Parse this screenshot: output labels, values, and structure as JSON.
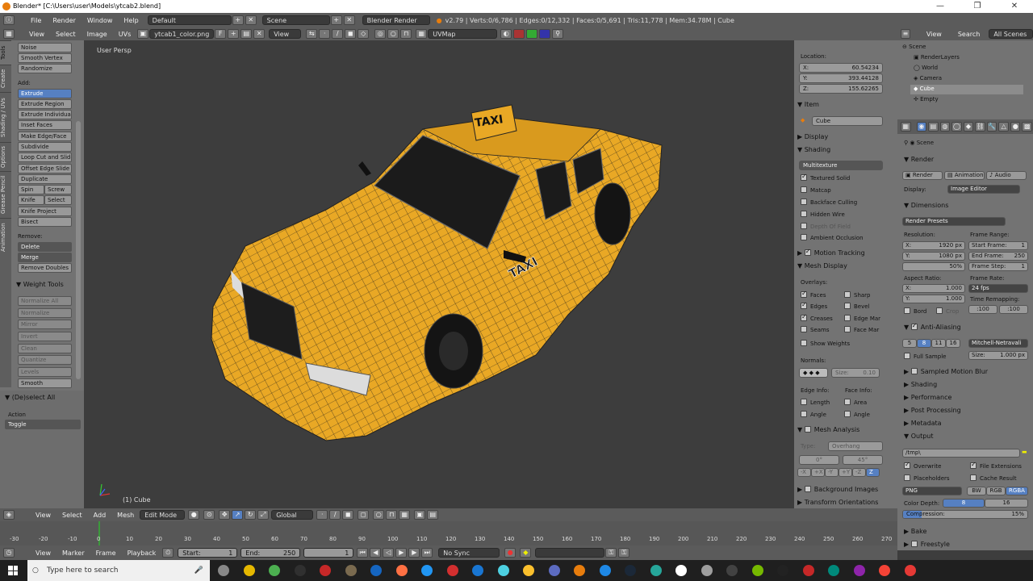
{
  "titlebar": {
    "title": "Blender* [C:\\Users\\user\\Models\\ytcab2.blend]",
    "min": "—",
    "max": "❐",
    "close": "✕"
  },
  "infobar": {
    "menus": [
      "File",
      "Render",
      "Window",
      "Help"
    ],
    "screen": "Default",
    "scene": "Scene",
    "engine": "Blender Render",
    "stats": "v2.79 | Verts:0/6,786 | Edges:0/12,332 | Faces:0/5,691 | Tris:11,778 | Mem:34.78M | Cube"
  },
  "imageheader": {
    "menus": [
      "View",
      "Select",
      "Image",
      "UVs"
    ],
    "image": "ytcab1_color.png",
    "f": "F",
    "view": "View",
    "uvmap": "UVMap"
  },
  "tooltabs": [
    "Tools",
    "Create",
    "Shading / UVs",
    "Options",
    "Grease Pencil",
    "Animation"
  ],
  "tools": {
    "top": [
      "Noise",
      "Smooth Vertex",
      "Randomize"
    ],
    "add_label": "Add:",
    "extrude": "Extrude",
    "add": [
      "Extrude Region",
      "Extrude Individual",
      "Inset Faces",
      "Make Edge/Face",
      "Subdivide",
      "Loop Cut and Slide",
      "Offset Edge Slide",
      "Duplicate"
    ],
    "spin": "Spin",
    "screw": "Screw",
    "knife": "Knife",
    "select": "Select",
    "more": [
      "Knife Project",
      "Bisect"
    ],
    "remove_label": "Remove:",
    "delete": "Delete",
    "merge": "Merge",
    "remove_doubles": "Remove Doubles",
    "weight_title": "Weight Tools",
    "weight": [
      "Normalize All",
      "Normalize",
      "Mirror",
      "Invert",
      "Clean",
      "Quantize",
      "Levels"
    ],
    "smooth": "Smooth",
    "op_title": "(De)select All",
    "action_label": "Action",
    "action": "Toggle"
  },
  "viewport": {
    "label": "User Persp",
    "object": "(1) Cube",
    "sign": "TAXI",
    "door": "TAXI"
  },
  "npanel": {
    "location_label": "Location:",
    "x": "X:",
    "xv": "60.54234",
    "y": "Y:",
    "yv": "393.44128",
    "z": "Z:",
    "zv": "155.62265",
    "item": "Item",
    "item_name": "Cube",
    "display": "Display",
    "shading": "Shading",
    "shading_mode": "Multitexture",
    "shading_opts": [
      "Textured Solid",
      "Matcap",
      "Backface Culling",
      "Hidden Wire",
      "Depth Of Field",
      "Ambient Occlusion"
    ],
    "motion": "Motion Tracking",
    "mesh_display": "Mesh Display",
    "overlays": "Overlays:",
    "ov_left": [
      "Faces",
      "Edges",
      "Creases",
      "Seams",
      "Show Weights"
    ],
    "ov_right": [
      "Sharp",
      "Bevel",
      "Edge Mar",
      "Face Mar"
    ],
    "normals": "Normals:",
    "size": "Size:",
    "size_v": "0.10",
    "edge_info": "Edge Info:",
    "face_info": "Face Info:",
    "length": "Length",
    "angle": "Angle",
    "area": "Area",
    "angle2": "Angle",
    "mesh_analysis": "Mesh Analysis",
    "type": "Type:",
    "type_v": "Overhang",
    "deg0": "0°",
    "deg45": "45°",
    "axes": [
      "-X",
      "+X",
      "-Y",
      "+Y",
      "-Z",
      "Z"
    ],
    "bg_images": "Background Images",
    "transform_orient": "Transform Orientations"
  },
  "outliner": {
    "view": "View",
    "search": "Search",
    "all": "All Scenes",
    "items": [
      "Scene",
      "RenderLayers",
      "World",
      "Camera",
      "Cube",
      "Empty"
    ]
  },
  "props": {
    "scene": "Scene",
    "render": "Render",
    "btn_render": "Render",
    "btn_anim": "Animation",
    "btn_audio": "Audio",
    "display": "Display:",
    "display_v": "Image Editor",
    "dimensions": "Dimensions",
    "presets": "Render Presets",
    "resolution": "Resolution:",
    "frame_range": "Frame Range:",
    "rx": "X:",
    "rxv": "1920 px",
    "ry": "Y:",
    "ryv": "1080 px",
    "pct": "50%",
    "start": "Start Frame:",
    "start_v": "1",
    "end": "End Frame:",
    "end_v": "250",
    "step": "Frame Step:",
    "step_v": "1",
    "aspect": "Aspect Ratio:",
    "frame_rate": "Frame Rate:",
    "ax": "X:",
    "axv": "1.000",
    "ay": "Y:",
    "ayv": "1.000",
    "fps": "24 fps",
    "time_remap": "Time Remapping:",
    "old": ":100",
    "new": ":100",
    "bord": "Bord",
    "crop": "Crop",
    "aa": "Anti-Aliasing",
    "aa_vals": [
      "5",
      "8",
      "11",
      "16"
    ],
    "filter": "Mitchell-Netravali",
    "full_sample": "Full Sample",
    "fsize": "Size:",
    "fsize_v": "1.000 px",
    "sections": [
      "Sampled Motion Blur",
      "Shading",
      "Performance",
      "Post Processing",
      "Metadata",
      "Output"
    ],
    "path": "/tmp\\",
    "overwrite": "Overwrite",
    "file_ext": "File Extensions",
    "placeholders": "Placeholders",
    "cache": "Cache Result",
    "format": "PNG",
    "bw": "BW",
    "rgb": "RGB",
    "rgba": "RGBA",
    "depth": "Color Depth:",
    "d8": "8",
    "d16": "16",
    "compression": "Compression:",
    "comp_v": "15%",
    "comp_fill": 0.15,
    "bake": "Bake",
    "freestyle": "Freestyle"
  },
  "header3": {
    "menus": [
      "View",
      "Select",
      "Add",
      "Mesh"
    ],
    "mode": "Edit Mode",
    "orient": "Global"
  },
  "timeline": {
    "ticks": [
      "-30",
      "-20",
      "-10",
      "0",
      "10",
      "20",
      "30",
      "40",
      "50",
      "60",
      "70",
      "80",
      "90",
      "100",
      "110",
      "120",
      "130",
      "140",
      "150",
      "160",
      "170",
      "180",
      "190",
      "200",
      "210",
      "220",
      "230",
      "240",
      "250",
      "260",
      "270"
    ]
  },
  "header4": {
    "menus": [
      "View",
      "Marker",
      "Frame",
      "Playback"
    ],
    "start": "Start:",
    "start_v": "1",
    "end": "End:",
    "end_v": "250",
    "current": "1",
    "sync": "No Sync"
  },
  "taskbar": {
    "search": "Type here to search"
  },
  "colors": {
    "accent": "#5680c2",
    "taxi": "#e9a825",
    "orange": "#e87d0d"
  }
}
